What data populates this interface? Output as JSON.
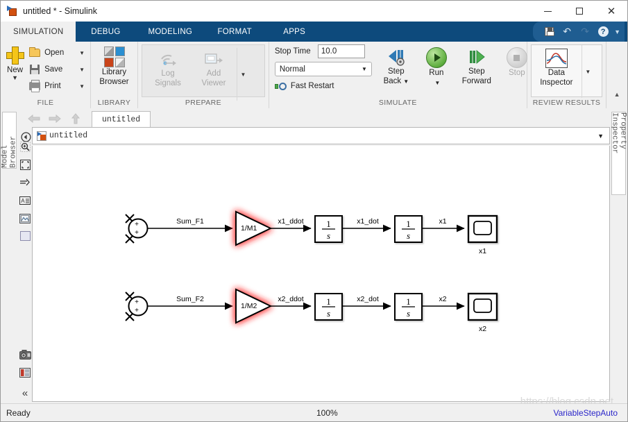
{
  "window": {
    "title": "untitled * - Simulink",
    "minimize_label": "–",
    "maximize_label": "",
    "close_label": "✕"
  },
  "ribbon": {
    "tabs": [
      {
        "label": "SIMULATION",
        "active": true
      },
      {
        "label": "DEBUG",
        "active": false
      },
      {
        "label": "MODELING",
        "active": false
      },
      {
        "label": "FORMAT",
        "active": false
      },
      {
        "label": "APPS",
        "active": false
      }
    ],
    "quick_access": [
      {
        "name": "save-icon",
        "label": ""
      },
      {
        "name": "undo-icon",
        "label": "↶"
      },
      {
        "name": "redo-icon",
        "label": "↷"
      },
      {
        "name": "help-icon",
        "label": "?"
      },
      {
        "name": "chevron-down-icon",
        "label": "▼"
      }
    ],
    "groups": {
      "file": {
        "label": "FILE",
        "new_label": "New",
        "new_caret": "▼",
        "items": [
          {
            "label": "Open",
            "caret": "▼",
            "icon": "folder-icon"
          },
          {
            "label": "Save",
            "caret": "▼",
            "icon": "disk-icon"
          },
          {
            "label": "Print",
            "caret": "▼",
            "icon": "printer-icon"
          }
        ]
      },
      "library": {
        "label": "LIBRARY",
        "button_line1": "Library",
        "button_line2": "Browser"
      },
      "prepare": {
        "label": "PREPARE",
        "log_line1": "Log",
        "log_line2": "Signals",
        "viewer_line1": "Add",
        "viewer_line2": "Viewer",
        "overflow_caret": "▼"
      },
      "simulate": {
        "label": "SIMULATE",
        "stop_time_label": "Stop Time",
        "stop_time_value": "10.0",
        "mode_value": "Normal",
        "mode_caret": "▼",
        "fast_restart_label": "Fast Restart",
        "step_back_line1": "Step",
        "step_back_line2": "Back",
        "step_back_caret": "▼",
        "run_line1": "Run",
        "run_line2": "",
        "run_caret": "▼",
        "step_fwd_line1": "Step",
        "step_fwd_line2": "Forward",
        "stop_line1": "Stop",
        "stop_line2": ""
      },
      "review": {
        "label": "REVIEW RESULTS",
        "data_inspector_line1": "Data",
        "data_inspector_line2": "Inspector",
        "overflow_caret": "▼"
      }
    },
    "collapse_caret": "▲"
  },
  "side_tabs": {
    "model_browser": "Model Browser",
    "property_inspector": "Property Inspector"
  },
  "editor": {
    "nav": {
      "back": "←",
      "forward": "→",
      "up": "↑"
    },
    "model_tab": "untitled",
    "breadcrumb": {
      "back_arrow": "⊕",
      "text": "untitled",
      "caret": "▼"
    },
    "canvas_tools": [
      {
        "name": "zoom-in-icon",
        "glyph": "⊕"
      },
      {
        "name": "fit-to-view-icon",
        "glyph": "⛶"
      },
      {
        "name": "signal-routing-icon",
        "glyph": "↠"
      },
      {
        "name": "annotation-icon",
        "glyph": "A"
      },
      {
        "name": "image-icon",
        "glyph": "▨"
      },
      {
        "name": "area-icon",
        "glyph": "□"
      },
      {
        "name": "camera-icon",
        "glyph": "◎"
      },
      {
        "name": "report-icon",
        "glyph": "▤"
      },
      {
        "name": "collapse-toolbar-icon",
        "glyph": "«"
      }
    ]
  },
  "diagram": {
    "rows": [
      {
        "sum_label": "Sum_F1",
        "gain_label": "1/M1",
        "gain_highlighted": true,
        "signal_after_gain": "x1_ddot",
        "integrator1_num": "1",
        "integrator1_den": "s",
        "signal_mid": "x1_dot",
        "integrator2_num": "1",
        "integrator2_den": "s",
        "signal_out": "x1",
        "scope_label": "x1"
      },
      {
        "sum_label": "Sum_F2",
        "gain_label": "1/M2",
        "gain_highlighted": true,
        "signal_after_gain": "x2_ddot",
        "integrator1_num": "1",
        "integrator1_den": "s",
        "signal_mid": "x2_dot",
        "integrator2_num": "1",
        "integrator2_den": "s",
        "signal_out": "x2",
        "scope_label": "x2"
      }
    ],
    "sum_signs": [
      "+",
      "+"
    ],
    "highlight_color": "#ff3b3b"
  },
  "status": {
    "ready": "Ready",
    "zoom": "100%",
    "solver": "VariableStepAuto",
    "watermark": "https://blog.csdn.net"
  }
}
